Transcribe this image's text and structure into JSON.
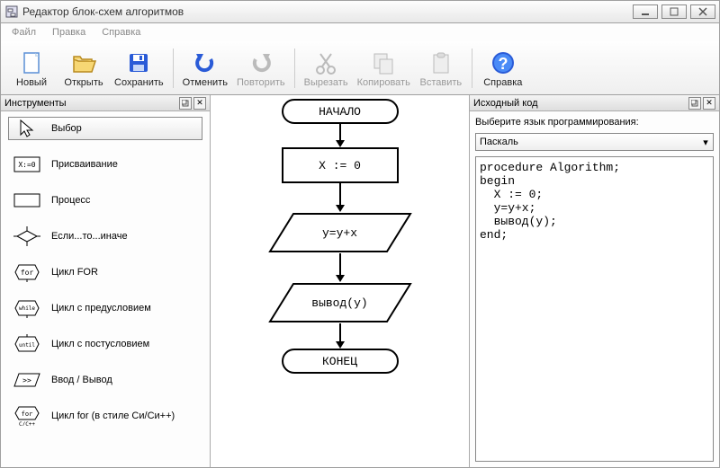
{
  "window": {
    "title": "Редактор блок-схем алгоритмов"
  },
  "menu": {
    "file": "Файл",
    "edit": "Правка",
    "help": "Справка"
  },
  "toolbar": {
    "new": "Новый",
    "open": "Открыть",
    "save": "Сохранить",
    "undo": "Отменить",
    "redo": "Повторить",
    "cut": "Вырезать",
    "copy": "Копировать",
    "paste": "Вставить",
    "help": "Справка"
  },
  "tools_panel": {
    "title": "Инструменты",
    "items": [
      "Выбор",
      "Присваивание",
      "Процесс",
      "Если...то...иначе",
      "Цикл FOR",
      "Цикл с предусловием",
      "Цикл с постусловием",
      "Ввод / Вывод",
      "Цикл for (в стиле Си/Си++)"
    ]
  },
  "flowchart": {
    "start": "НАЧАЛО",
    "assign": "X := 0",
    "proc1": "y=y+x",
    "proc2": "вывод(y)",
    "end": "КОНЕЦ"
  },
  "source_panel": {
    "title": "Исходный код",
    "label": "Выберите язык программирования:",
    "language": "Паскаль",
    "code": "procedure Algorithm;\nbegin\n  X := 0;\n  y=y+x;\n  вывод(y);\nend;"
  }
}
